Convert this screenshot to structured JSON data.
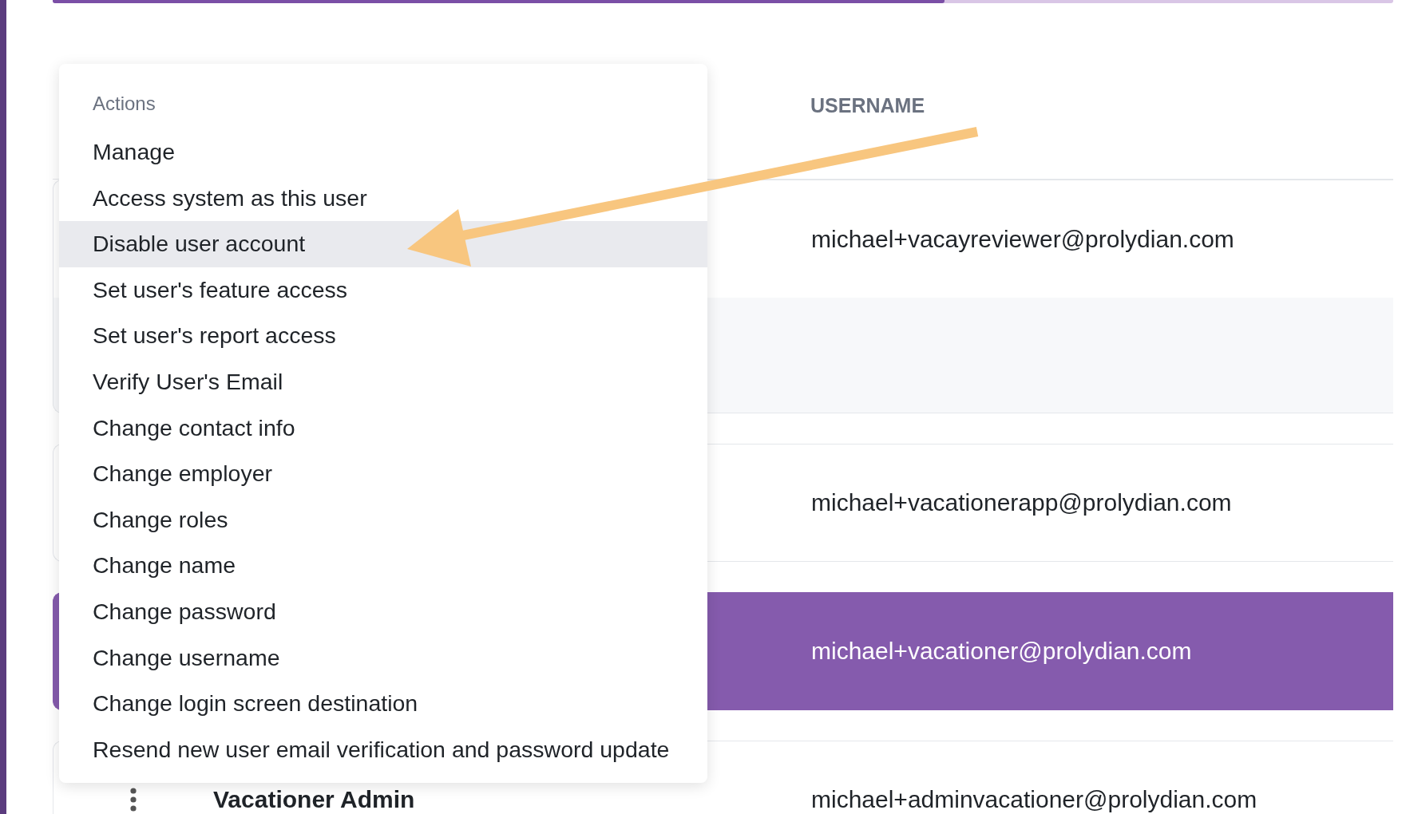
{
  "progress": {
    "level": 0.665
  },
  "table": {
    "columns": [
      {
        "label": "USERNAME"
      }
    ],
    "rows": [
      {
        "kind": "user",
        "username": "michael+vacayreviewer@prolydian.com",
        "selected": false
      },
      {
        "kind": "detail",
        "selected": false
      },
      {
        "kind": "user",
        "username": "michael+vacationerapp@prolydian.com",
        "selected": false
      },
      {
        "kind": "user",
        "username": "michael+vacationer@prolydian.com",
        "selected": true
      },
      {
        "kind": "user",
        "name": "Vacationer Admin",
        "username": "michael+adminvacationer@prolydian.com",
        "selected": false
      }
    ]
  },
  "actions_menu": {
    "title": "Actions",
    "items": [
      {
        "label": "Manage",
        "selected": false
      },
      {
        "label": "Access system as this user",
        "selected": false
      },
      {
        "label": "Disable user account",
        "selected": true
      },
      {
        "label": "Set user's feature access",
        "selected": false
      },
      {
        "label": "Set user's report access",
        "selected": false
      },
      {
        "label": "Verify User's Email",
        "selected": false
      },
      {
        "label": "Change contact info",
        "selected": false
      },
      {
        "label": "Change employer",
        "selected": false
      },
      {
        "label": "Change roles",
        "selected": false
      },
      {
        "label": "Change name",
        "selected": false
      },
      {
        "label": "Change password",
        "selected": false
      },
      {
        "label": "Change username",
        "selected": false
      },
      {
        "label": "Change login screen destination",
        "selected": false
      },
      {
        "label": "Resend new user email verification and password update",
        "selected": false
      }
    ]
  }
}
